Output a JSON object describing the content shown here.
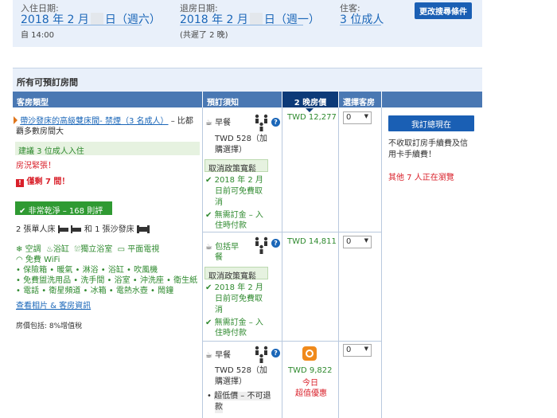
{
  "search": {
    "checkin_label": "入住日期:",
    "checkin_date_prefix": "2018 年 2 月",
    "checkin_date_suffix": "日（週六）",
    "checkin_time": "自 14:00",
    "checkout_label": "退房日期:",
    "checkout_date_prefix": "2018 年 2 月",
    "checkout_date_suffix": "日（週一）",
    "nights_note": "(共遲了 2 晚)",
    "guests_label": "住客:",
    "guests_value": "3 位成人",
    "update_button": "更改搜尋條件"
  },
  "table": {
    "title": "所有可預訂房間",
    "headers": {
      "room_type": "客房類型",
      "notes": "預訂須知",
      "price": "2 晚房價",
      "select": "選擇客房"
    }
  },
  "room": {
    "name": "帶沙發床的高級雙床間- 禁煙（3 名成人）",
    "name_suffix": "– 比都",
    "name_line2": "覇多數房間大",
    "recommend": "建議 3 位成人入住",
    "hot": "房況緊張！",
    "only_left": "僅剩 7 間！",
    "clean_badge": "非常乾淨 – 168 則評語",
    "beds_a": "2 張單人床",
    "beds_b": "和 1 張沙發床",
    "amen_ac": "空調",
    "amen_bath": "浴缸",
    "amen_private": "獨立浴室",
    "amen_tv": "平面電視",
    "amen_wifi": "免費 WiFi",
    "amen_list_1": "• 保險箱 • 暖氣 • 淋浴 • 浴缸 • 吹風機",
    "amen_list_2": "• 免費盥洗用品 • 洗手間 • 浴室 • 沖洗座 • 衛生紙",
    "amen_list_3": "• 電話 • 衛星頻道 • 冰箱 • 電熱水壺 • 鬧鐘",
    "photos_link": "查看相片 & 客房資訊",
    "price_includes": "房價包括: 8%增值稅"
  },
  "options": [
    {
      "meal": "早餐",
      "meal_price_1": "TWD 528（加",
      "meal_price_2": "購選擇）",
      "policy_button": "取消政策寬鬆",
      "cancel_1": "2018 年 2 月",
      "cancel_2": "日前可免費取",
      "cancel_3": "消",
      "deposit_1": "無需訂金 – 入",
      "deposit_2": "住時付款",
      "price": "TWD 12,277",
      "qty": "0"
    },
    {
      "meal_1": "包括早",
      "meal_2": "餐",
      "policy_button": "取消政策寬鬆",
      "cancel_1": "2018 年 2 月",
      "cancel_2": "日前可免費取",
      "cancel_3": "消",
      "deposit_1": "無需訂金 – 入",
      "deposit_2": "住時付款",
      "price": "TWD 14,811",
      "qty": "0"
    },
    {
      "meal": "早餐",
      "meal_price_1": "TWD 528（加",
      "meal_price_2": "購選擇）",
      "note_1": "超低價 – 不可退",
      "note_2": "款",
      "price": "TWD 9,822",
      "deal_1": "今日",
      "deal_2": "超值優惠",
      "qty": "0"
    }
  ],
  "sidebar": {
    "reserve_button": "我訂總現在",
    "fee_note_1": "不收取訂房手續費及信",
    "fee_note_2": "用卡手續費！",
    "viewing": "其他 7 人正在瀏覽"
  },
  "colors": {
    "accent": "#1a5fb4",
    "header": "#4a78b3",
    "price_header": "#0c3a78",
    "green": "#2f8a2f",
    "red": "#d9202a",
    "summary_bg": "#e9f0fa"
  }
}
